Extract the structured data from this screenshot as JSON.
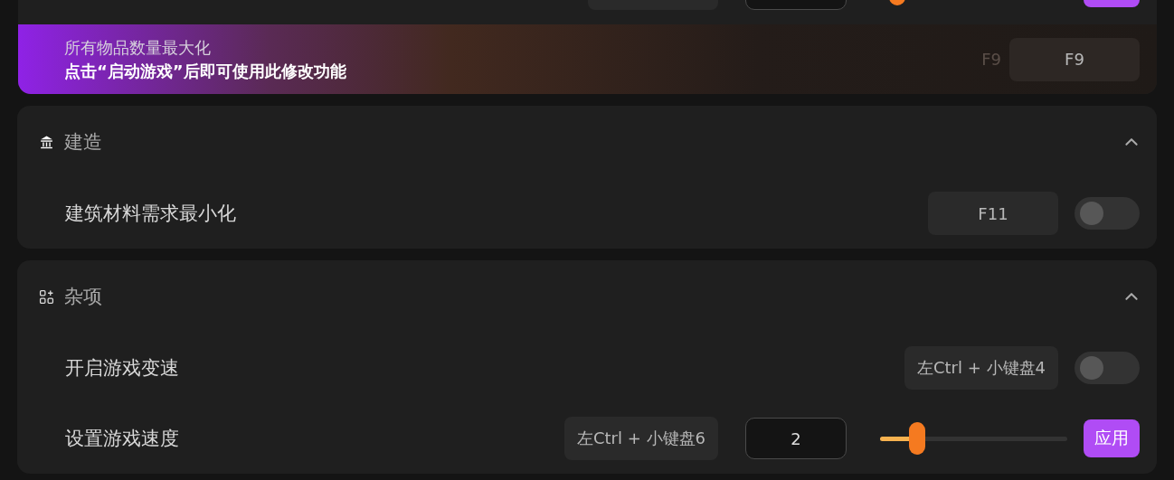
{
  "top_card": {
    "rows": [
      {
        "kind": "slider",
        "level": 0.09
      }
    ],
    "banner": {
      "title": "所有物品数量最大化",
      "subtitle": "点击“启动游戏”后即可使用此修改功能",
      "ghost_hotkey": "F9",
      "hotkey": "F9"
    }
  },
  "sections": [
    {
      "title": "建造",
      "expanded": true,
      "rows": [
        {
          "kind": "toggle",
          "label": "建筑材料需求最小化",
          "hotkey": "F11",
          "on": false
        }
      ]
    },
    {
      "title": "杂项",
      "expanded": true,
      "rows": [
        {
          "kind": "toggle",
          "label": "开启游戏变速",
          "hotkey": "左Ctrl + 小键盘4",
          "on": false
        },
        {
          "kind": "slider",
          "label": "设置游戏速度",
          "hotkey": "左Ctrl + 小键盘6",
          "value": "2",
          "level": 0.2,
          "button": "应用"
        }
      ]
    }
  ]
}
